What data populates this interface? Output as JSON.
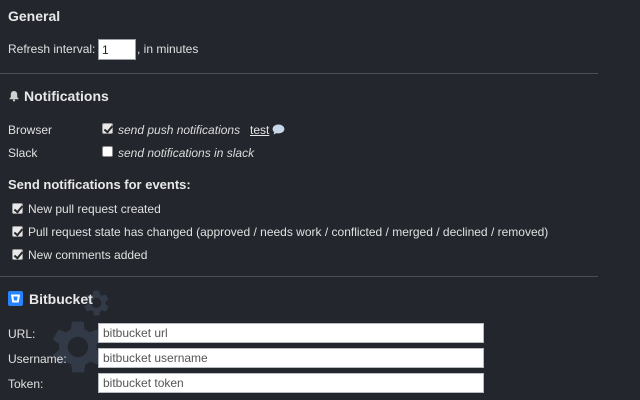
{
  "general": {
    "heading": "General",
    "refresh_label": "Refresh interval:",
    "refresh_value": "1",
    "refresh_suffix": ", in minutes"
  },
  "notifications": {
    "heading": "Notifications",
    "browser": {
      "label": "Browser",
      "checked": true,
      "option": "send push notifications",
      "test_link": "test"
    },
    "slack": {
      "label": "Slack",
      "checked": false,
      "option": "send notifications in slack"
    },
    "events_heading": "Send notifications for events:",
    "events": [
      {
        "label": "New pull request created",
        "checked": true
      },
      {
        "label": "Pull request state has changed (approved / needs work / conflicted / merged / declined / removed)",
        "checked": true
      },
      {
        "label": "New comments added",
        "checked": true
      }
    ]
  },
  "bitbucket": {
    "heading": "Bitbucket",
    "url": {
      "label": "URL:",
      "placeholder": "bitbucket url"
    },
    "username": {
      "label": "Username:",
      "placeholder": "bitbucket username"
    },
    "token": {
      "label": "Token:",
      "placeholder": "bitbucket token"
    }
  },
  "colors": {
    "background": "#23262d",
    "bitbucket_brand": "#2684ff"
  }
}
